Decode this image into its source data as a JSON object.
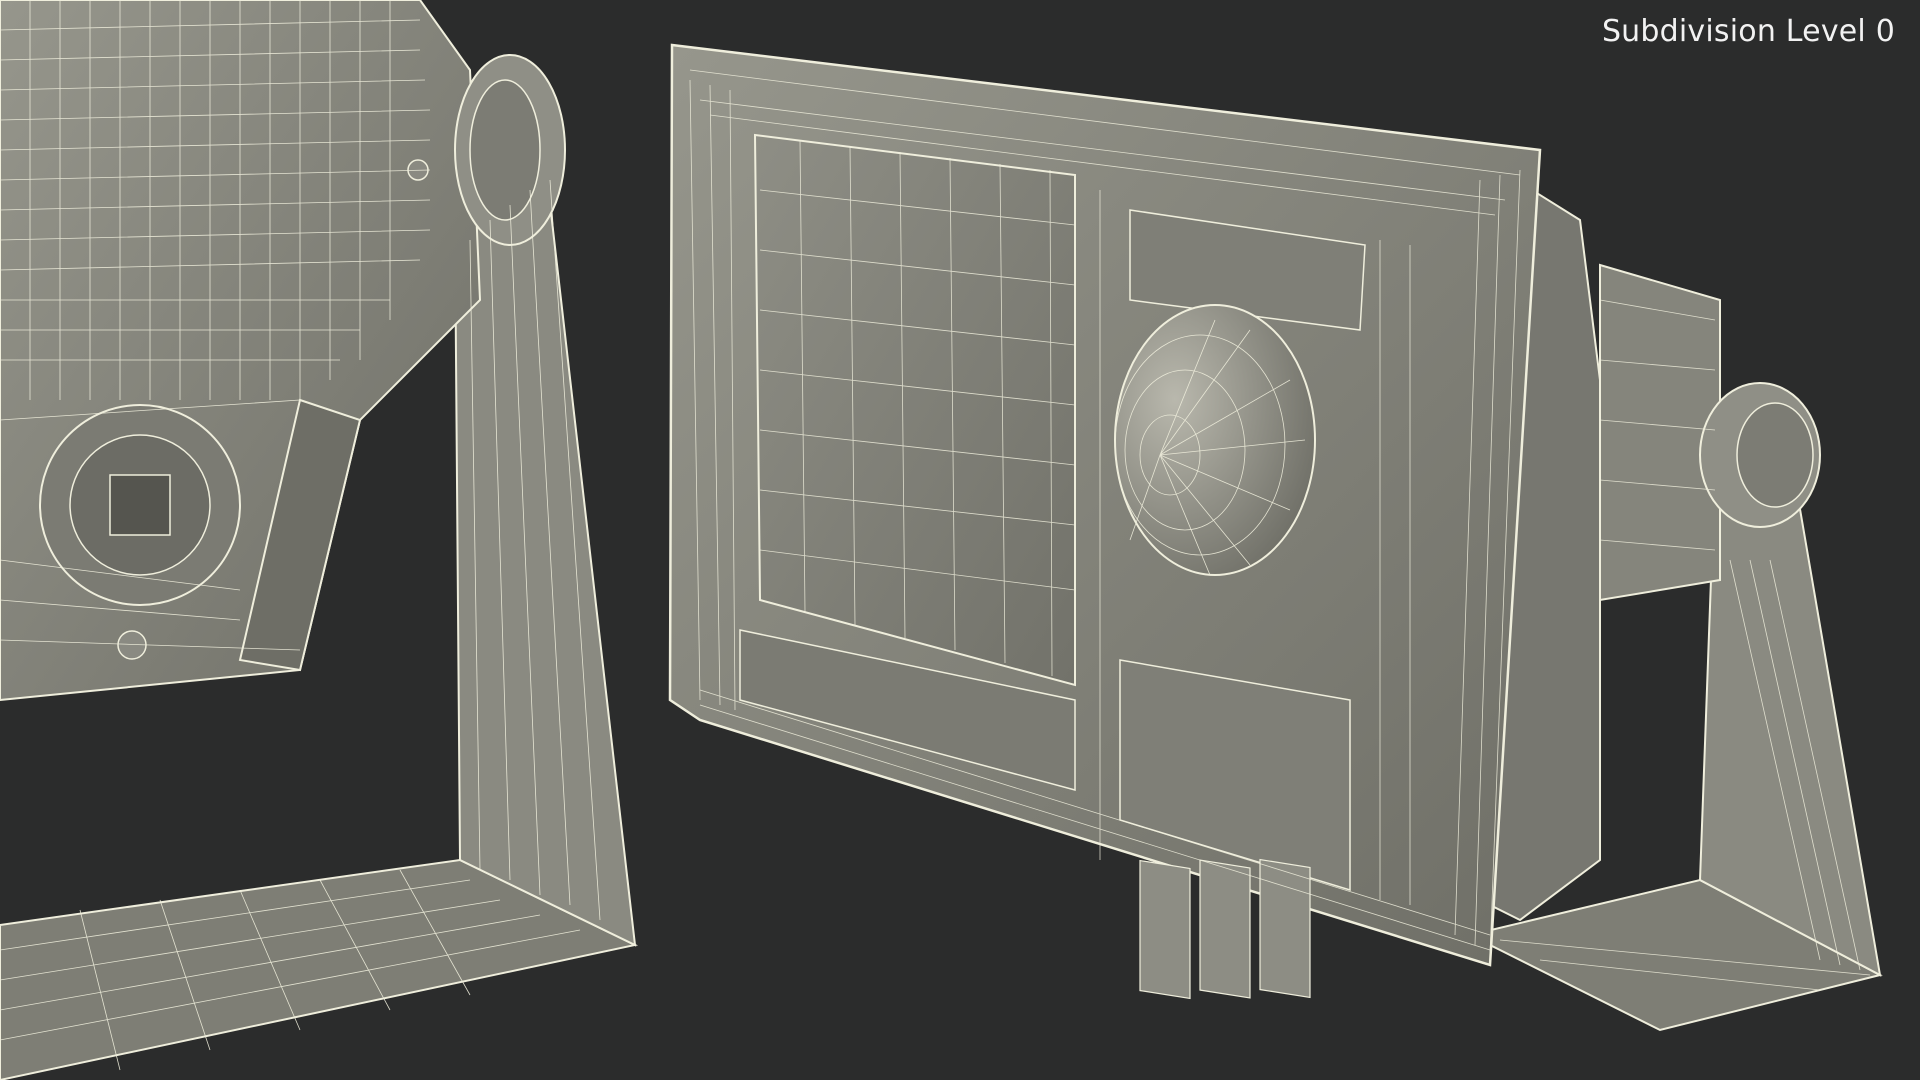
{
  "overlay": {
    "subdivision_label": "Subdivision Level 0"
  },
  "colors": {
    "background": "#2b2c2c",
    "surface": "#8b8b82",
    "surface_dark": "#66665e",
    "surface_shadow": "#4a4a44",
    "wire": "#f1f0df",
    "label": "#f2f2f2"
  },
  "icons": {
    "left_part": "bracket-knob-connector",
    "right_part": "marine-display-on-bracket"
  }
}
